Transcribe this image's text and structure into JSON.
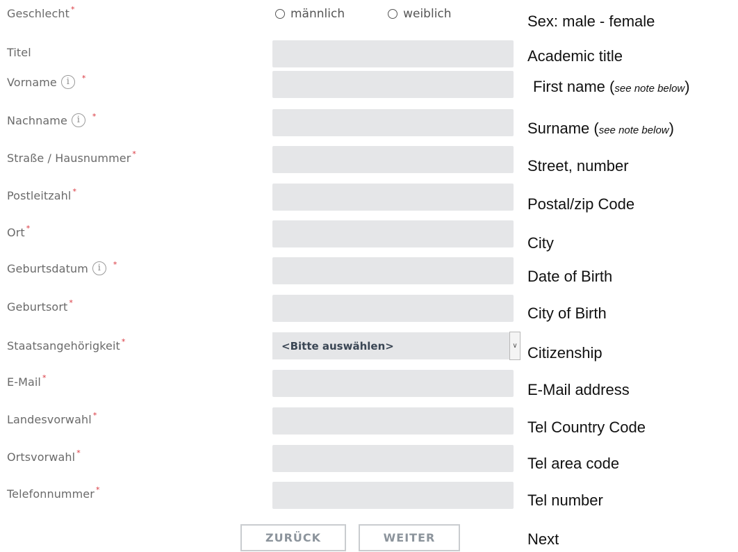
{
  "gender": {
    "label": "Geschlecht",
    "required": "*",
    "option_male": "männlich",
    "option_female": "weiblich",
    "translation": "Sex: male - female"
  },
  "fields": [
    {
      "label": "Titel",
      "required": "",
      "info": false,
      "translation": "Academic title",
      "note": ""
    },
    {
      "label": "Vorname",
      "required": "*",
      "info": true,
      "translation": "First name (",
      "note": "see note below",
      "after": ")"
    },
    {
      "label": "Nachname",
      "required": "*",
      "info": true,
      "translation": "Surname (",
      "note": "see note below",
      "after": ")"
    },
    {
      "label": "Straße / Hausnummer",
      "required": "*",
      "info": false,
      "translation": "Street, number"
    },
    {
      "label": "Postleitzahl",
      "required": "*",
      "info": false,
      "translation": "Postal/zip Code"
    },
    {
      "label": "Ort",
      "required": "*",
      "info": false,
      "translation": "City"
    },
    {
      "label": "Geburtsdatum",
      "required": "*",
      "info": true,
      "translation": "Date of Birth"
    },
    {
      "label": "Geburtsort",
      "required": "*",
      "info": false,
      "translation": "City of Birth"
    },
    {
      "label": "Staatsangehörigkeit",
      "required": "*",
      "info": false,
      "translation": "Citizenship",
      "select_value": "<Bitte auswählen>"
    },
    {
      "label": "E-Mail",
      "required": "*",
      "info": false,
      "translation": "E-Mail address"
    },
    {
      "label": "Landesvorwahl",
      "required": "*",
      "info": false,
      "translation": "Tel Country Code"
    },
    {
      "label": "Ortsvorwahl",
      "required": "*",
      "info": false,
      "translation": "Tel area code"
    },
    {
      "label": "Telefonnummer",
      "required": "*",
      "info": false,
      "translation": "Tel number"
    }
  ],
  "info_glyph": "i",
  "buttons": {
    "back": "ZURÜCK",
    "next": "WEITER",
    "next_translation": "Next"
  },
  "colors": {
    "required": "#d9363e",
    "field_bg": "#e5e6e8",
    "label": "#6a6a6a"
  }
}
